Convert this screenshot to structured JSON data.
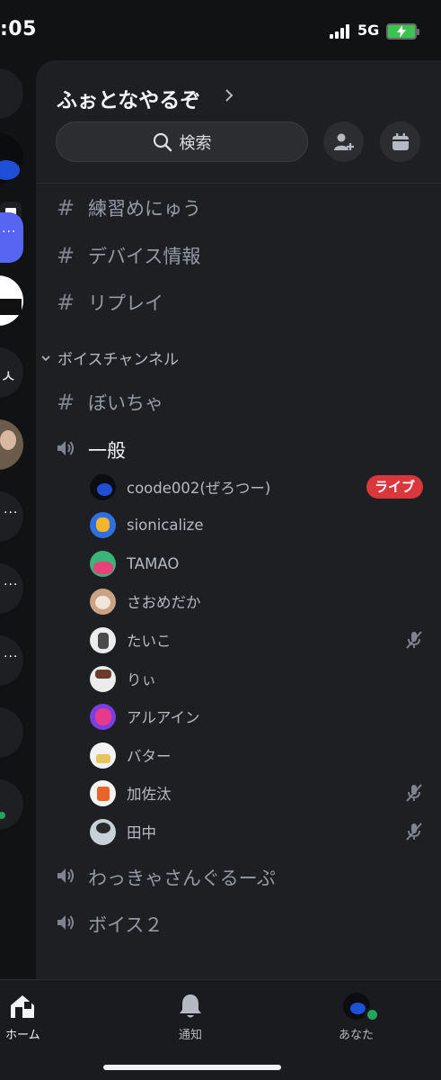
{
  "status_bar": {
    "time": ":05",
    "network": "5G"
  },
  "server": {
    "name": "ふぉとなやるぞ"
  },
  "search": {
    "label": "検索"
  },
  "text_channels": [
    {
      "name": "練習めにゅう"
    },
    {
      "name": "デバイス情報"
    },
    {
      "name": "リプレイ"
    }
  ],
  "category": {
    "name": "ボイスチャンネル"
  },
  "voice_section": {
    "text_channel": {
      "name": "ぼいちゃ"
    },
    "active_voice": {
      "name": "一般"
    },
    "members": [
      {
        "name": "coode002(ぜろつー)",
        "badge": "ライブ",
        "muted": false
      },
      {
        "name": "sionicalize",
        "muted": false
      },
      {
        "name": "TAMAO",
        "muted": false
      },
      {
        "name": "さおめだか",
        "muted": false
      },
      {
        "name": "たいこ",
        "muted": true
      },
      {
        "name": "りぃ",
        "muted": false
      },
      {
        "name": "アルアイン",
        "muted": false
      },
      {
        "name": "バター",
        "muted": false
      },
      {
        "name": "加佐汰",
        "muted": true
      },
      {
        "name": "田中",
        "muted": true
      }
    ],
    "other_voice": [
      {
        "name": "わっきゃさんぐるーぷ"
      },
      {
        "name": "ボイス２"
      }
    ]
  },
  "bottom_nav": {
    "home": "ホーム",
    "notifications": "通知",
    "you": "あなた"
  },
  "colors": {
    "live": "#da373c",
    "online": "#23a55a",
    "panel": "#1e1f22",
    "background": "#111214"
  }
}
